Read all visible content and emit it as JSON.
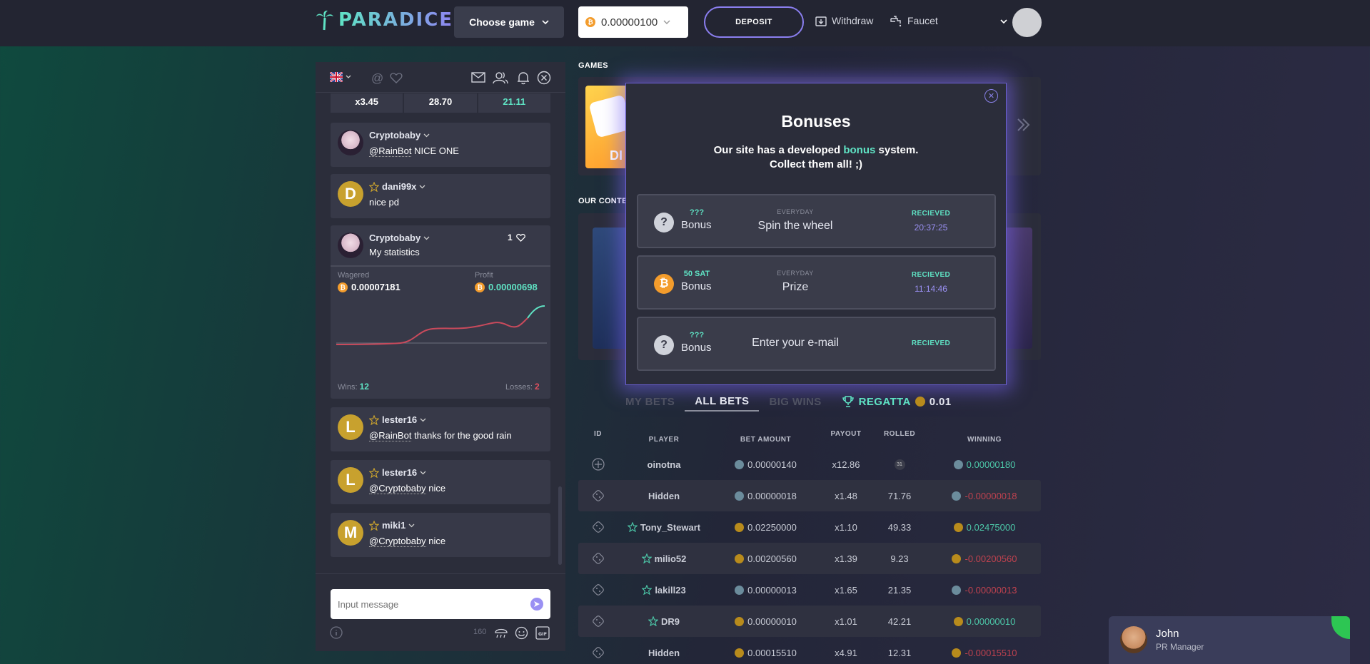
{
  "header": {
    "logo_text": "PARADICE",
    "choose_game": "Choose game",
    "balance": "0.00000100",
    "deposit": "DEPOSIT",
    "withdraw": "Withdraw",
    "faucet": "Faucet"
  },
  "chat": {
    "top_stats": [
      "x3.45",
      "28.70",
      "21.11"
    ],
    "messages": [
      {
        "user": "Cryptobaby",
        "mention": "@RainBot",
        "text": " NICE ONE",
        "avatar": ""
      },
      {
        "user": "dani99x",
        "mention": "",
        "text": "nice pd",
        "avatar": "D"
      },
      {
        "user": "Cryptobaby",
        "mention": "",
        "text": "My statistics",
        "avatar": ""
      },
      {
        "user": "lester16",
        "mention": "@RainBot",
        "text": " thanks for the good rain",
        "avatar": "L"
      },
      {
        "user": "lester16",
        "mention": "@Cryptobaby",
        "text": " nice",
        "avatar": "L"
      },
      {
        "user": "miki1",
        "mention": "@Cryptobaby",
        "text": " nice",
        "avatar": "M"
      }
    ],
    "stat_card": {
      "likes": "1",
      "wagered_label": "Wagered",
      "wagered": "0.00007181",
      "profit_label": "Profit",
      "profit": "0.00000698",
      "wins_label": "Wins:",
      "wins": "12",
      "losses_label": "Losses:",
      "losses": "2"
    },
    "input_placeholder": "Input message",
    "char_count": "160"
  },
  "sections": {
    "games": "GAMES",
    "contests": "OUR CONTE"
  },
  "modal": {
    "title": "Bonuses",
    "subtitle_pre": "Our site has a developed ",
    "subtitle_hl": "bonus",
    "subtitle_post": " system.",
    "subtitle_line2": "Collect them all! ;)",
    "bonuses": [
      {
        "amount": "???",
        "name": "Bonus",
        "every": "EVERYDAY",
        "desc": "Spin the wheel",
        "status": "RECIEVED",
        "timer": "20:37:25",
        "icon": "?"
      },
      {
        "amount": "50 SAT",
        "name": "Bonus",
        "every": "EVERYDAY",
        "desc": "Prize",
        "status": "RECIEVED",
        "timer": "11:14:46",
        "icon": "₿"
      },
      {
        "amount": "???",
        "name": "Bonus",
        "every": "",
        "desc": "Enter your e-mail",
        "status": "RECIEVED",
        "timer": "",
        "icon": "?"
      }
    ]
  },
  "tabs": {
    "my_bets": "MY BETS",
    "all_bets": "ALL BETS",
    "big_wins": "BIG WINS",
    "regatta": "REGATTA",
    "regatta_value": "0.01"
  },
  "table": {
    "headers": {
      "id": "ID",
      "player": "PLAYER",
      "bet": "BET AMOUNT",
      "payout": "PAYOUT",
      "rolled": "ROLLED",
      "winning": "WINNING"
    },
    "rows": [
      {
        "player": "oinotna",
        "bet": "0.00000140",
        "payout": "x12.86",
        "rolled": "31",
        "winning": "0.00000180",
        "win_pos": true,
        "coin": "grey",
        "star": false
      },
      {
        "player": "Hidden",
        "bet": "0.00000018",
        "payout": "x1.48",
        "rolled": "71.76",
        "winning": "-0.00000018",
        "win_pos": false,
        "coin": "grey",
        "star": false
      },
      {
        "player": "Tony_Stewart",
        "bet": "0.02250000",
        "payout": "x1.10",
        "rolled": "49.33",
        "winning": "0.02475000",
        "win_pos": true,
        "coin": "gold",
        "star": true
      },
      {
        "player": "milio52",
        "bet": "0.00200560",
        "payout": "x1.39",
        "rolled": "9.23",
        "winning": "-0.00200560",
        "win_pos": false,
        "coin": "gold",
        "star": true
      },
      {
        "player": "lakill23",
        "bet": "0.00000013",
        "payout": "x1.65",
        "rolled": "21.35",
        "winning": "-0.00000013",
        "win_pos": false,
        "coin": "grey",
        "star": true
      },
      {
        "player": "DR9",
        "bet": "0.00000010",
        "payout": "x1.01",
        "rolled": "42.21",
        "winning": "0.00000010",
        "win_pos": true,
        "coin": "gold",
        "star": true
      },
      {
        "player": "Hidden",
        "bet": "0.00015510",
        "payout": "x4.91",
        "rolled": "12.31",
        "winning": "-0.00015510",
        "win_pos": false,
        "coin": "gold",
        "star": false
      }
    ]
  },
  "support": {
    "name": "John",
    "role": "PR Manager"
  },
  "colors": {
    "accent": "#5fe3c4",
    "purple": "#8b7ff0",
    "negative": "#c0424f",
    "bitcoin": "#f39c2c"
  }
}
